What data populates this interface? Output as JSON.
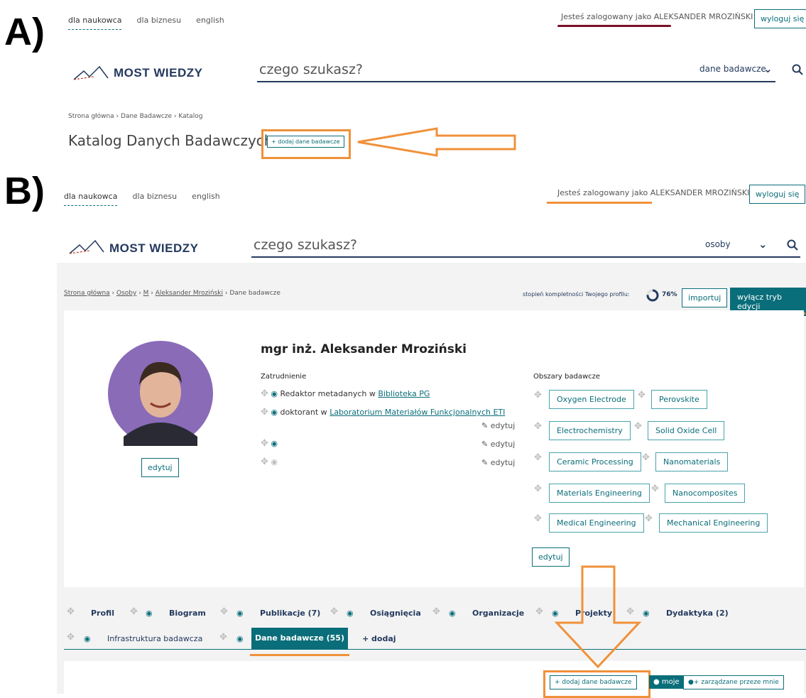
{
  "labels": {
    "a": "A)",
    "b": "B)"
  },
  "panel_a": {
    "nav": [
      "dla naukowca",
      "dla biznesu",
      "english"
    ],
    "login_prefix": "Jesteś zalogowany jako ",
    "login_name": "ALEKSANDER MROZIŃSKI",
    "logout": "wyloguj się",
    "logo": "MOST WIEDZY",
    "search_placeholder": "czego szukasz?",
    "search_scope": "dane badawcze",
    "breadcrumb": [
      "Strona główna",
      "Dane Badawcze",
      "Katalog"
    ],
    "page_title": "Katalog Danych Badawczych",
    "add_button": "+ dodaj dane badawcze"
  },
  "panel_b": {
    "nav": [
      "dla naukowca",
      "dla biznesu",
      "english"
    ],
    "login_prefix": "Jesteś zalogowany jako ",
    "login_name": "ALEKSANDER MROZIŃSKI",
    "logout": "wyloguj się",
    "logo": "MOST WIEDZY",
    "search_placeholder": "czego szukasz?",
    "search_scope": "osoby",
    "breadcrumb": [
      "Strona główna",
      "Osoby",
      "M",
      "Aleksander Mroziński",
      "Dane badawcze"
    ],
    "completeness_label": "stopień kompletności Twojego profilu:",
    "completeness_value": "76%",
    "completeness_fraction": 0.76,
    "import_button": "importuj",
    "edit_mode_button": "wyłącz tryb edycji",
    "profile": {
      "name": "mgr inż. Aleksander Mroziński",
      "photo_edit": "edytuj",
      "employment_heading": "Zatrudnienie",
      "employment": [
        {
          "prefix": "Redaktor metadanych w ",
          "org": "Biblioteka PG"
        },
        {
          "prefix": "doktorant w ",
          "org": "Laboratorium Materiałów Funkcjonalnych ETI"
        }
      ],
      "edit_link": "edytuj",
      "research_heading": "Obszary badawcze",
      "research_areas": [
        "Oxygen Electrode",
        "Perovskite",
        "Electrochemistry",
        "Solid Oxide Cell",
        "Ceramic Processing",
        "Nanomaterials",
        "Materials Engineering",
        "Nanocomposites",
        "Medical Engineering",
        "Mechanical Engineering"
      ],
      "research_edit": "edytuj"
    },
    "tabs": [
      "Profil",
      "Biogram",
      "Publikacje (7)",
      "Osiągnięcia",
      "Organizacje",
      "Projekty",
      "Dydaktyka (2)",
      "Infrastruktura badawcza",
      "Dane badawcze (55)",
      "+ dodaj"
    ],
    "bottom_buttons": [
      "+ dodaj dane badawcze",
      "moje",
      "zarządzane przeze mnie"
    ]
  },
  "colors": {
    "teal": "#0a6e7a",
    "navy": "#243a5e",
    "orange": "#f0913a",
    "dark_red": "#7a1028"
  }
}
